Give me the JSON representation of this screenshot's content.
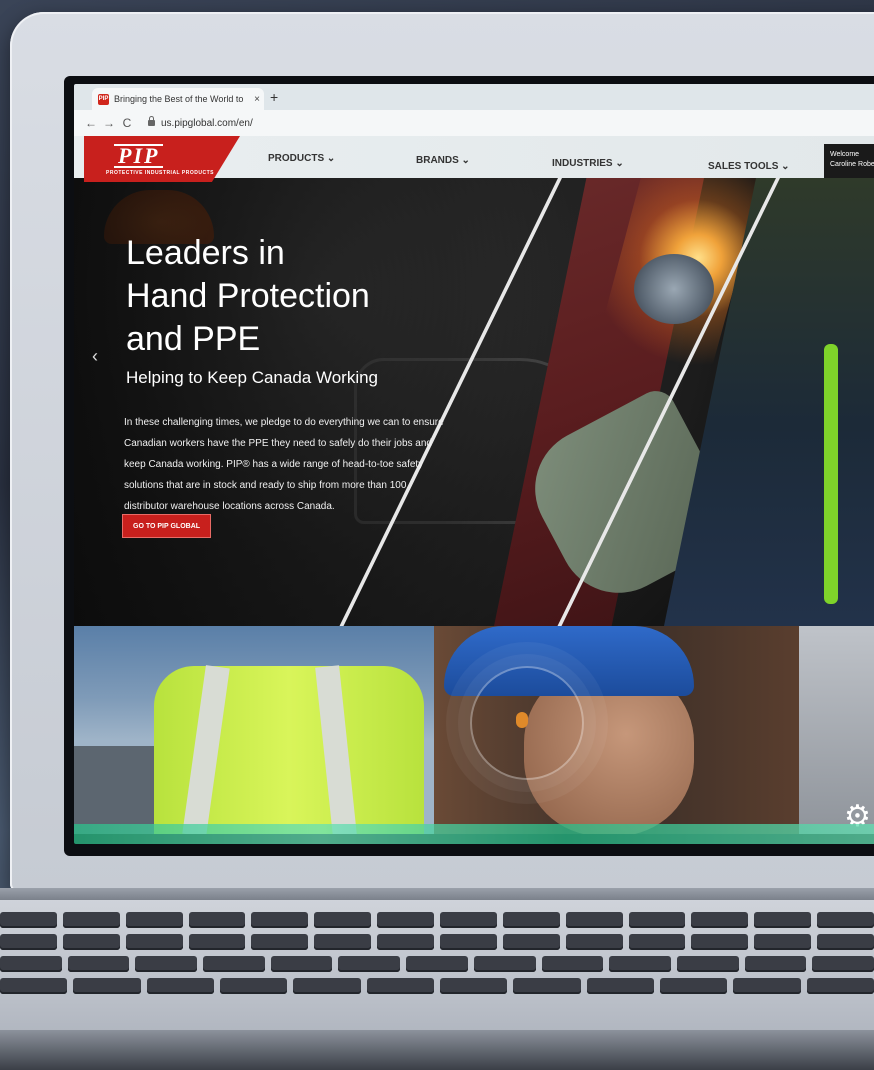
{
  "browser": {
    "tab_title": "Bringing the Best of the World to",
    "tab_close": "×",
    "new_tab": "+",
    "nav_back": "←",
    "nav_forward": "→",
    "nav_reload": "C",
    "url": "us.pipglobal.com/en/"
  },
  "site": {
    "logo_text": "PIP",
    "logo_subtitle": "PROTECTIVE INDUSTRIAL PRODUCTS",
    "nav": [
      {
        "label": "PRODUCTS ⌄"
      },
      {
        "label": "BRANDS ⌄"
      },
      {
        "label": "INDUSTRIES ⌄"
      },
      {
        "label": "SALES TOOLS ⌄"
      }
    ],
    "welcome_label": "Welcome",
    "welcome_name": "Caroline Robe"
  },
  "hero": {
    "title_line1": "Leaders in",
    "title_line2": "Hand Protection",
    "title_line3": "and PPE",
    "subtitle": "Helping to Keep Canada Working",
    "body": "In these challenging times, we pledge to do everything we can to ensure Canadian workers have the PPE they need to safely do their jobs and keep Canada working. PIP® has a wide range of head-to-toe safety solutions that are in stock and ready to ship from more than 100 distributor warehouse locations across Canada.",
    "cta": "GO TO PIP GLOBAL",
    "prev_arrow": "‹"
  },
  "icons": {
    "settings": "⚙"
  }
}
